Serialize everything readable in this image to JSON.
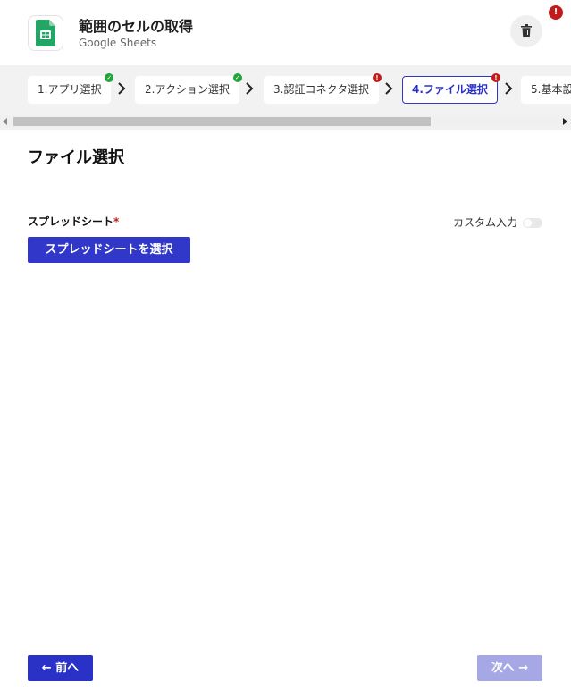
{
  "header": {
    "title": "範囲のセルの取得",
    "subtitle": "Google Sheets",
    "alert_badge": "!"
  },
  "steps": [
    {
      "label": "1.アプリ選択",
      "status": "ok"
    },
    {
      "label": "2.アクション選択",
      "status": "ok"
    },
    {
      "label": "3.認証コネクタ選択",
      "status": "error"
    },
    {
      "label": "4.ファイル選択",
      "status": "error",
      "active": true
    },
    {
      "label": "5.基本設",
      "status": "none"
    }
  ],
  "content": {
    "section_title": "ファイル選択",
    "field_label": "スプレッドシート",
    "required_mark": "*",
    "custom_input_label": "カスタム入力",
    "custom_input_on": false,
    "select_button": "スプレッドシートを選択"
  },
  "footer": {
    "prev_button": "← 前へ",
    "next_button": "次へ →",
    "next_enabled": false
  },
  "colors": {
    "primary": "#3037c9",
    "disabled": "#a6a8e6",
    "success": "#21a33b",
    "error": "#c21b1b",
    "sheets_green": "#23a566"
  },
  "icons": {
    "app": "google-sheets-icon",
    "trash": "trash-icon",
    "chevron": "chevron-right-icon"
  }
}
